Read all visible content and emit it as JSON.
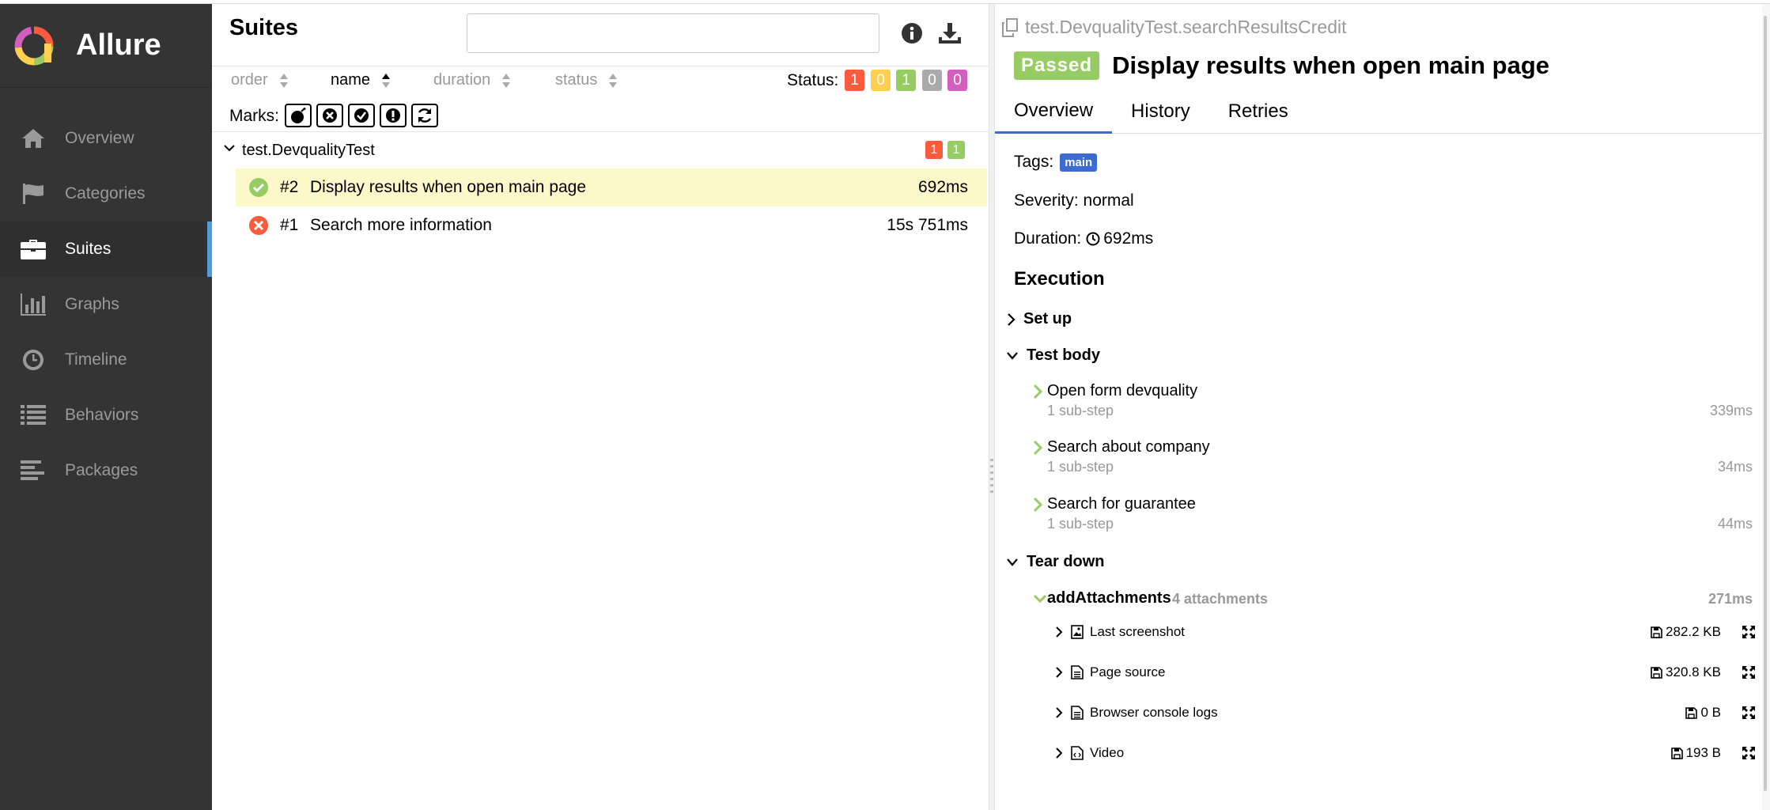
{
  "app": {
    "name": "Allure"
  },
  "sidebar": {
    "items": [
      {
        "label": "Overview",
        "icon": "home-icon"
      },
      {
        "label": "Categories",
        "icon": "flag-icon"
      },
      {
        "label": "Suites",
        "icon": "briefcase-icon",
        "active": true
      },
      {
        "label": "Graphs",
        "icon": "bar-chart-icon"
      },
      {
        "label": "Timeline",
        "icon": "clock-icon"
      },
      {
        "label": "Behaviors",
        "icon": "list-icon"
      },
      {
        "label": "Packages",
        "icon": "align-left-icon"
      }
    ]
  },
  "suites": {
    "title": "Suites",
    "search_value": "",
    "sort": {
      "order": "order",
      "name": "name",
      "duration": "duration",
      "status": "status"
    },
    "status_label": "Status:",
    "status_counts": {
      "failed": "1",
      "broken": "0",
      "passed": "1",
      "skipped": "0",
      "unknown": "0"
    },
    "marks_label": "Marks:",
    "group": {
      "name": "test.DevqualityTest",
      "failed": "1",
      "passed": "1"
    },
    "tests": [
      {
        "num": "#2",
        "name": "Display results when open main page",
        "duration": "692ms",
        "status": "passed"
      },
      {
        "num": "#1",
        "name": "Search more information",
        "duration": "15s 751ms",
        "status": "failed"
      }
    ]
  },
  "detail": {
    "full_name": "test.DevqualityTest.searchResultsCredit",
    "status": "Passed",
    "title": "Display results when open main page",
    "tabs": [
      "Overview",
      "History",
      "Retries"
    ],
    "tags_label": "Tags:",
    "tag": "main",
    "severity": "Severity: normal",
    "duration_label": "Duration:",
    "duration": "692ms",
    "execution_title": "Execution",
    "setup_label": "Set up",
    "testbody_label": "Test body",
    "teardown_label": "Tear down",
    "steps": [
      {
        "name": "Open form devquality",
        "sub": "1 sub-step",
        "duration": "339ms"
      },
      {
        "name": "Search about company",
        "sub": "1 sub-step",
        "duration": "34ms"
      },
      {
        "name": "Search for guarantee",
        "sub": "1 sub-step",
        "duration": "44ms"
      }
    ],
    "teardown_step": {
      "name": "addAttachments",
      "count": "4 attachments",
      "duration": "271ms"
    },
    "attachments": [
      {
        "name": "Last screenshot",
        "size": "282.2 KB",
        "icon": "image-file-icon"
      },
      {
        "name": "Page source",
        "size": "320.8 KB",
        "icon": "text-file-icon"
      },
      {
        "name": "Browser console logs",
        "size": "0 B",
        "icon": "text-file-icon"
      },
      {
        "name": "Video",
        "size": "193 B",
        "icon": "code-file-icon"
      }
    ]
  },
  "colors": {
    "failed": "#fd5a3e",
    "broken": "#ffd050",
    "passed": "#97cc64",
    "skipped": "#aaaaaa",
    "unknown": "#d35ebe",
    "sidebar": "#343434",
    "accent": "#4f9cdc",
    "tag": "#3e6bcf",
    "selected_row": "#fdf8c9"
  }
}
